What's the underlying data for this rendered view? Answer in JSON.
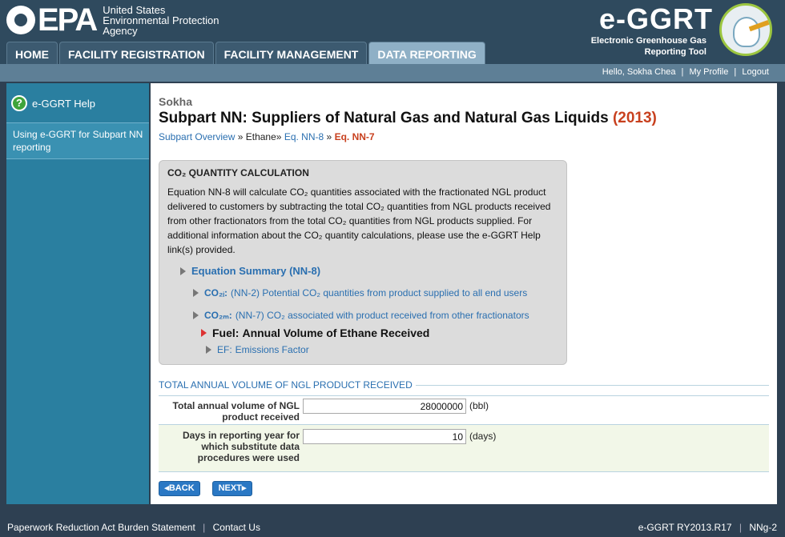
{
  "header": {
    "agency_line1": "United States",
    "agency_line2": "Environmental Protection",
    "agency_line3": "Agency",
    "epa_logo_text": "EPA",
    "app_title": "e-GGRT",
    "app_sub1": "Electronic Greenhouse Gas",
    "app_sub2": "Reporting Tool"
  },
  "nav": {
    "tabs": [
      "HOME",
      "FACILITY REGISTRATION",
      "FACILITY MANAGEMENT",
      "DATA REPORTING"
    ],
    "active": "DATA REPORTING"
  },
  "userbar": {
    "greeting": "Hello, Sokha Chea",
    "sep": "|",
    "profile": "My Profile",
    "logout": "Logout"
  },
  "sidebar": {
    "help_title": "e-GGRT Help",
    "help_link": "Using e-GGRT for Subpart NN reporting"
  },
  "page": {
    "facility": "Sokha",
    "title": "Subpart NN: Suppliers of Natural Gas and Natural Gas Liquids",
    "year": "(2013)",
    "breadcrumb": {
      "item1": "Subpart Overview",
      "sep": "»",
      "item2": "Ethane",
      "item3": "Eq. NN-8",
      "item4": "Eq. NN-7"
    }
  },
  "calc": {
    "title": "CO₂ QUANTITY CALCULATION",
    "description": "Equation NN-8 will calculate CO₂ quantities associated with the fractionated NGL product delivered to customers by subtracting the total CO₂ quantities from NGL products received from other fractionators from the total CO₂ quantities from NGL products supplied. For additional information about the CO₂ quantity calculations, please use the e-GGRT Help link(s) provided.",
    "summary": "Equation Summary (NN-8)",
    "items": [
      {
        "symbol": "CO₂ᵢ:",
        "text": "(NN-2) Potential CO₂ quantities from product supplied to all end users"
      },
      {
        "symbol": "CO₂ₘ:",
        "text": "(NN-7) CO₂ associated with product received from other fractionators"
      },
      {
        "symbol": "Fuel:",
        "text": "Annual Volume of Ethane Received"
      },
      {
        "symbol": "EF:",
        "text": "Emissions Factor"
      }
    ]
  },
  "form": {
    "section_title": "TOTAL ANNUAL VOLUME OF NGL PRODUCT RECEIVED",
    "rows": [
      {
        "label": "Total annual volume of NGL product received",
        "value": "28000000",
        "unit": "(bbl)"
      },
      {
        "label": "Days in reporting year for which substitute data procedures were used",
        "value": "10",
        "unit": "(days)"
      }
    ]
  },
  "buttons": {
    "back": "◂BACK",
    "next": "NEXT▸"
  },
  "footer": {
    "paperwork": "Paperwork Reduction Act Burden Statement",
    "sep": "|",
    "contact": "Contact Us",
    "version": "e-GGRT RY2013.R17",
    "page_id": "NNg-2"
  }
}
